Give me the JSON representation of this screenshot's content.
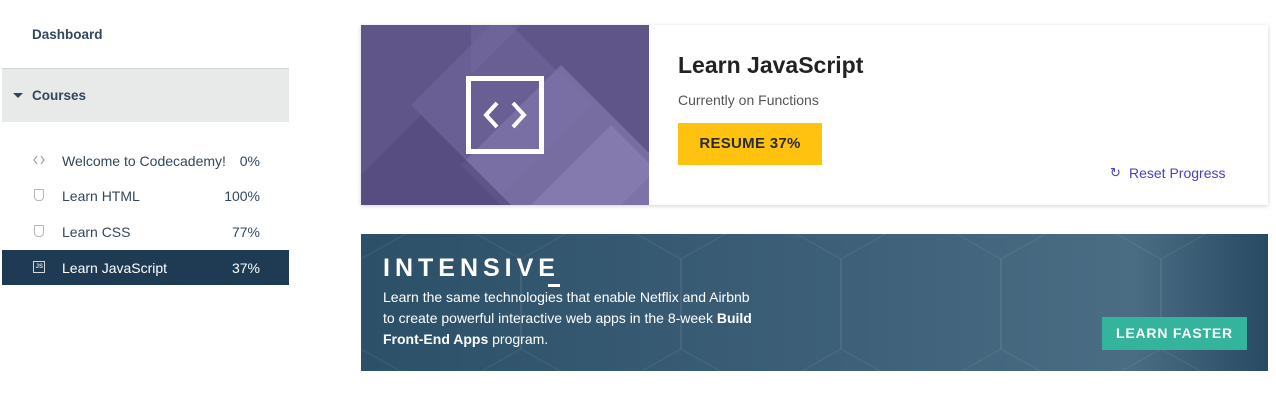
{
  "sidebar": {
    "dashboard_label": "Dashboard",
    "courses_label": "Courses",
    "items": [
      {
        "label": "Welcome to Codecademy!",
        "percent": "0%",
        "icon": "code-brackets-icon"
      },
      {
        "label": "Learn HTML",
        "percent": "100%",
        "icon": "html5-icon"
      },
      {
        "label": "Learn CSS",
        "percent": "77%",
        "icon": "css3-icon"
      },
      {
        "label": "Learn JavaScript",
        "percent": "37%",
        "icon": "js-icon",
        "active": true
      }
    ]
  },
  "course_card": {
    "title": "Learn JavaScript",
    "subtitle": "Currently on Functions",
    "resume_label": "RESUME 37%",
    "reset_label": "Reset Progress",
    "image_icon": "code-brackets-icon"
  },
  "intensive": {
    "heading": "INTENSIVE",
    "text_part1": "Learn the same technologies that enable Netflix and Airbnb to create powerful interactive web apps in the 8-week ",
    "text_bold": "Build Front-End Apps",
    "text_part2": " program.",
    "button_label": "LEARN FASTER"
  },
  "colors": {
    "sidebar_active_bg": "#1f3b54",
    "resume_button": "#ffc20e",
    "learn_button": "#34b39d",
    "reset_link": "#4a3fc7",
    "card_image": "#6b5f97"
  }
}
